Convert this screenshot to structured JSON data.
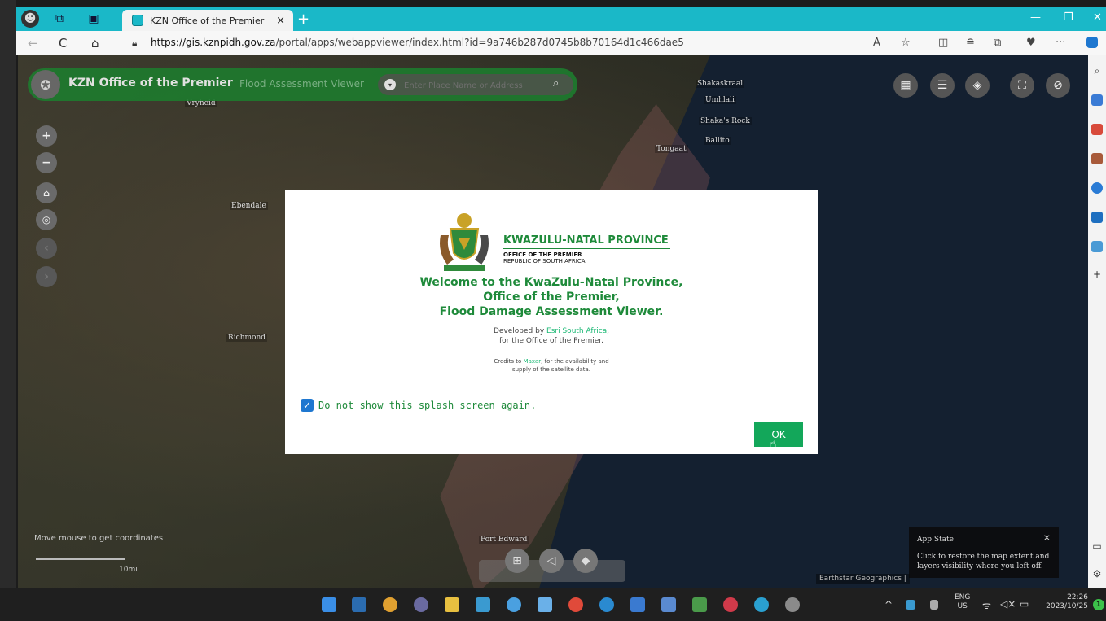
{
  "browser": {
    "tab_title": "KZN Office of the Premier",
    "tab_close": "×",
    "new_tab": "+",
    "url_host": "https://gis.kznpidh.gov.za",
    "url_path": "/portal/apps/webappviewer/index.html?id=9a746b287d0745b8b70164d1c466dae5",
    "window_minimize": "—",
    "window_restore": "❐",
    "window_close": "✕",
    "nav_back": "←",
    "nav_refresh": "C",
    "nav_home": "⌂",
    "toolbar_more": "···"
  },
  "app": {
    "title": "KZN Office of the Premier",
    "subtitle": "Flood Assessment Viewer",
    "search_placeholder": "Enter Place Name or Address"
  },
  "map": {
    "coords_hint": "Move mouse to get coordinates",
    "scale_label": "10mi",
    "attribution": "Earthstar Geographics |",
    "towns": {
      "t1": "Vryheid",
      "t2": "Ebendale",
      "t3": "Richmond",
      "t4": "Shakaskraal",
      "t5": "Umhlali",
      "t6": "Shaka's Rock",
      "t7": "Ballito",
      "t8": "Tongaat",
      "t9": "Port Edward"
    }
  },
  "toast": {
    "title": "App State",
    "message": "Click to restore the map extent and layers visibility where you left off.",
    "close": "×"
  },
  "splash": {
    "org_name": "KWAZULU-NATAL PROVINCE",
    "org_office": "OFFICE OF THE PREMIER",
    "org_country": "REPUBLIC OF SOUTH AFRICA",
    "welcome_line1": "Welcome to the KwaZulu-Natal Province,",
    "welcome_line2": "Office of the Premier,",
    "welcome_line3": "Flood Damage Assessment Viewer.",
    "dev_prefix": "Developed by ",
    "dev_link": "Esri South Africa",
    "dev_suffix": ",",
    "dev_line2": "for the Office of the Premier.",
    "credits_prefix": "Credits to ",
    "credits_link": "Maxar",
    "credits_suffix": ", for the availability and",
    "credits_line2": "supply of the satellite data.",
    "checkbox_label": "Do not show this splash screen again.",
    "checkbox_checked": true,
    "ok_label": "OK"
  },
  "taskbar": {
    "lang_top": "ENG",
    "lang_bottom": "US",
    "time": "22:26",
    "date": "2023/10/25",
    "notification_count": "1",
    "overflow": "^"
  },
  "colors": {
    "accent_green": "#1e8a3a",
    "ok_button": "#13a75a",
    "tab_bar": "#1ab8c8"
  }
}
